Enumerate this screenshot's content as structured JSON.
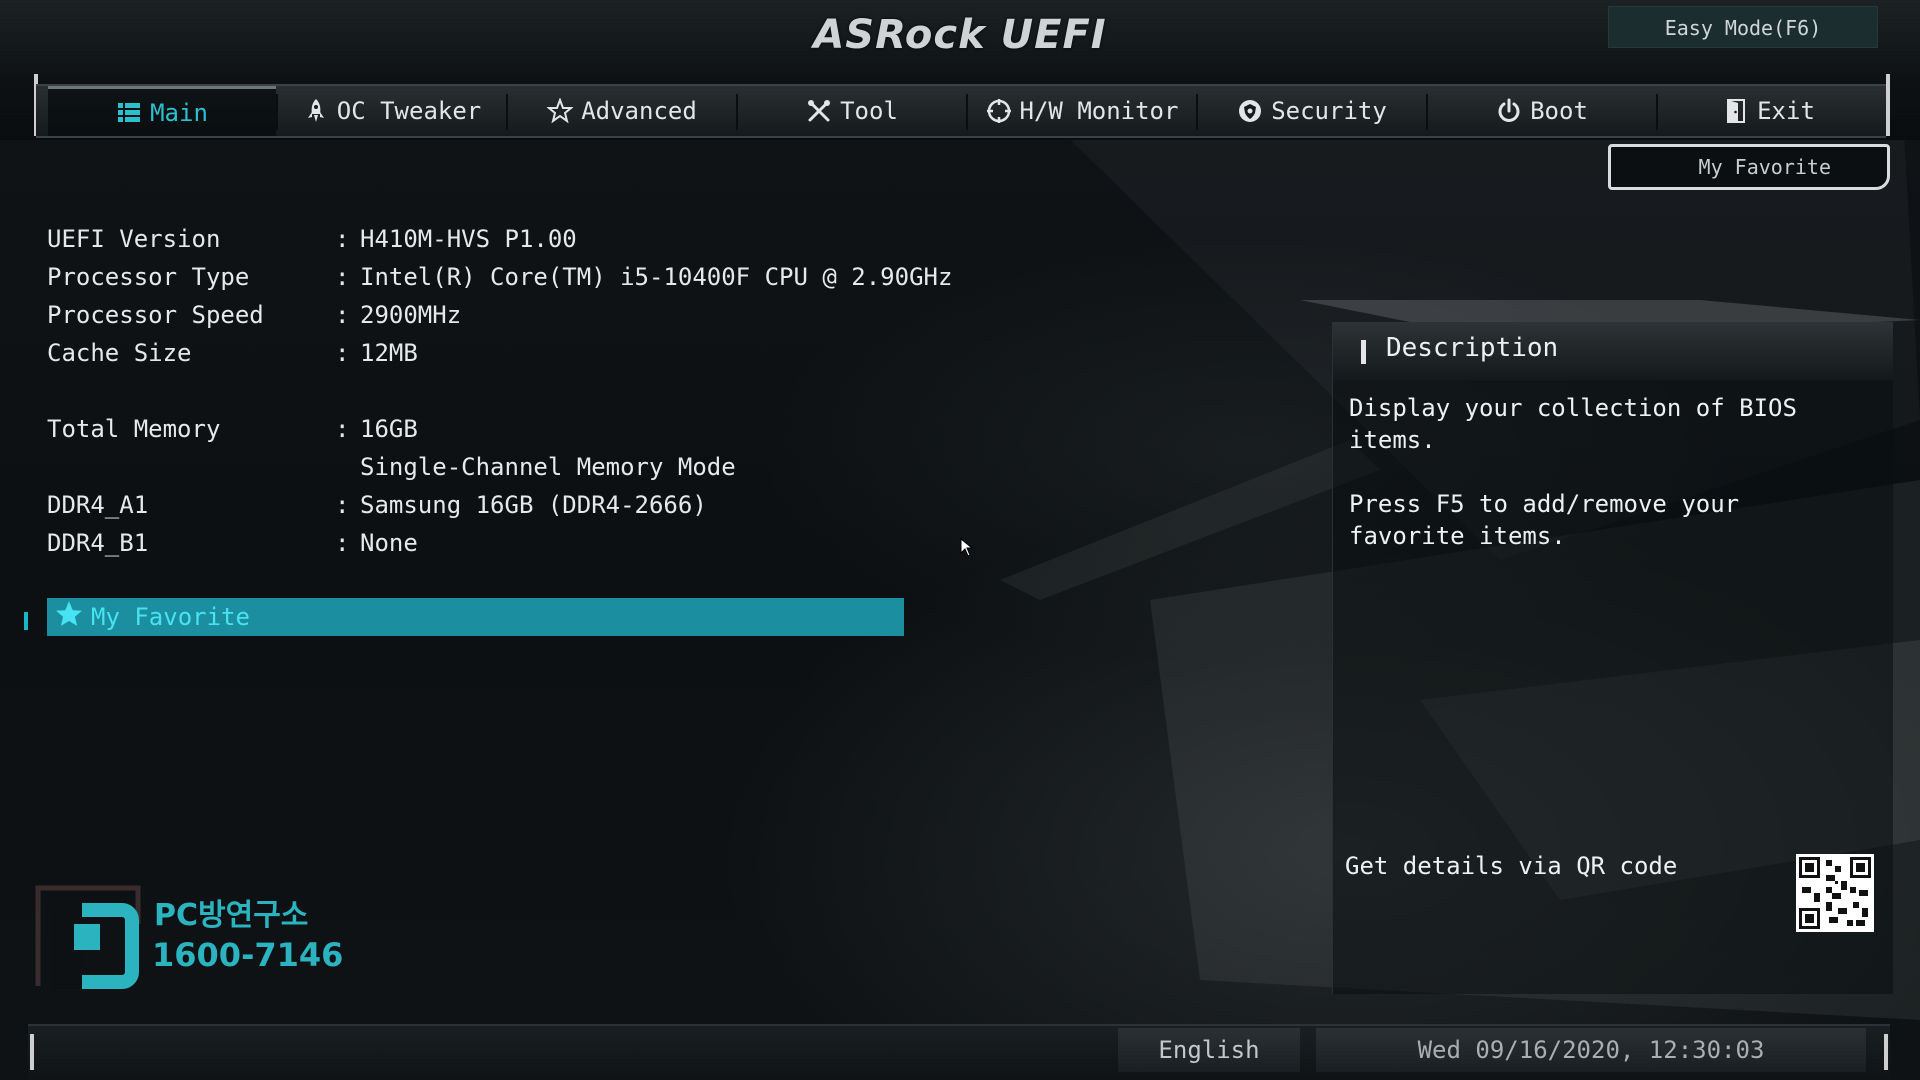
{
  "brand": {
    "logo": "ASRock UEFI"
  },
  "easy_mode": "Easy Mode(F6)",
  "tabs": [
    {
      "label": "Main",
      "icon": "list-icon",
      "active": true
    },
    {
      "label": "OC Tweaker",
      "icon": "rocket-icon",
      "active": false
    },
    {
      "label": "Advanced",
      "icon": "star-outline-icon",
      "active": false
    },
    {
      "label": "Tool",
      "icon": "tools-icon",
      "active": false
    },
    {
      "label": "H/W Monitor",
      "icon": "crosshair-icon",
      "active": false
    },
    {
      "label": "Security",
      "icon": "shield-badge-icon",
      "active": false
    },
    {
      "label": "Boot",
      "icon": "power-icon",
      "active": false
    },
    {
      "label": "Exit",
      "icon": "door-exit-icon",
      "active": false
    }
  ],
  "my_favorite_button": "My Favorite",
  "info": {
    "uefi_version": {
      "label": "UEFI Version",
      "value": "H410M-HVS P1.00"
    },
    "processor_type": {
      "label": "Processor Type",
      "value": "Intel(R) Core(TM) i5-10400F CPU @ 2.90GHz"
    },
    "processor_speed": {
      "label": "Processor Speed",
      "value": "2900MHz"
    },
    "cache_size": {
      "label": "Cache Size",
      "value": "12MB"
    },
    "total_memory": {
      "label": "Total Memory",
      "value": "16GB",
      "extra": "Single-Channel Memory Mode"
    },
    "ddr4_a1": {
      "label": "DDR4_A1",
      "value": "Samsung 16GB (DDR4-2666)"
    },
    "ddr4_b1": {
      "label": "DDR4_B1",
      "value": "None"
    },
    "colon": ":"
  },
  "favorite_item": "My Favorite",
  "description": {
    "title": "Description",
    "line1": "Display your collection of BIOS items.",
    "line2": "Press F5 to add/remove your favorite items.",
    "qr_label": "Get details via QR code"
  },
  "watermark": {
    "brand": "PC방연구소",
    "phone": "1600-7146"
  },
  "footer": {
    "language": "English",
    "datetime": "Wed 09/16/2020, 12:30:03"
  },
  "colors": {
    "accent": "#2cc0cf",
    "highlight": "#1b8fa0",
    "highlight_text": "#47e3f3"
  }
}
